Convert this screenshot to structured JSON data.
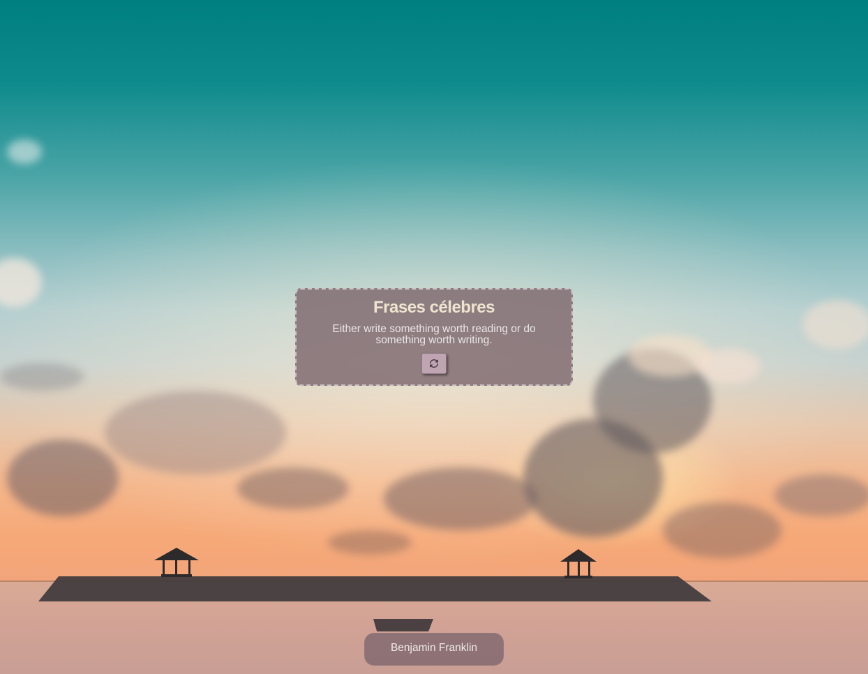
{
  "background": {
    "scene": "sunset-sea-with-gazebos-background",
    "colors": {
      "sky_top": "#007f80",
      "sky_mid": "#b5cfd0",
      "sunset": "#f4b58a",
      "water": "#d3a395"
    }
  },
  "quote_card": {
    "title": "Frases célebres",
    "quote": "Either write something worth reading or do something worth writing.",
    "refresh_icon": "refresh-icon",
    "card_color": "#7e686e",
    "title_color": "#eee5cf"
  },
  "author": {
    "name": "Benjamin Franklin"
  }
}
